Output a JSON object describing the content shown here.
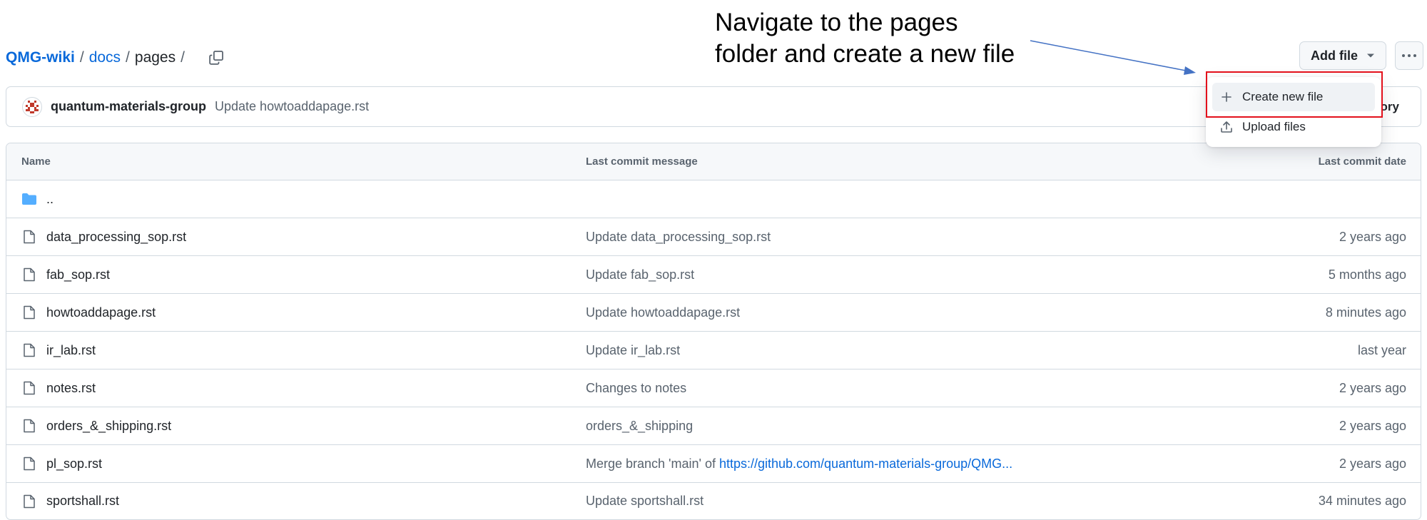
{
  "annotation": {
    "line1": "Navigate to the pages",
    "line2": "folder and create a new file"
  },
  "breadcrumb": {
    "repo": "QMG-wiki",
    "folder": "docs",
    "current": "pages",
    "separator": "/"
  },
  "toolbar": {
    "add_file_label": "Add file",
    "more_label": "···"
  },
  "dropdown": {
    "items": [
      {
        "label": "Create new file",
        "icon": "plus-icon"
      },
      {
        "label": "Upload files",
        "icon": "upload-icon"
      }
    ]
  },
  "commit": {
    "author": "quantum-materials-group",
    "message": "Update howtoaddapage.rst",
    "history_fragment": "ory"
  },
  "table": {
    "headers": {
      "name": "Name",
      "message": "Last commit message",
      "date": "Last commit date"
    },
    "parent_row": {
      "name": ".."
    },
    "rows": [
      {
        "name": "data_processing_sop.rst",
        "message": "Update data_processing_sop.rst",
        "date": "2 years ago"
      },
      {
        "name": "fab_sop.rst",
        "message": "Update fab_sop.rst",
        "date": "5 months ago"
      },
      {
        "name": "howtoaddapage.rst",
        "message": "Update howtoaddapage.rst",
        "date": "8 minutes ago"
      },
      {
        "name": "ir_lab.rst",
        "message": "Update ir_lab.rst",
        "date": "last year"
      },
      {
        "name": "notes.rst",
        "message": "Changes to notes",
        "date": "2 years ago"
      },
      {
        "name": "orders_&_shipping.rst",
        "message": "orders_&_shipping",
        "date": "2 years ago"
      },
      {
        "name": "pl_sop.rst",
        "message": "Merge branch 'main' of ",
        "message_link": "https://github.com/quantum-materials-group/QMG...",
        "date": "2 years ago"
      },
      {
        "name": "sportshall.rst",
        "message": "Update sportshall.rst",
        "date": "34 minutes ago"
      }
    ]
  },
  "colors": {
    "link": "#0969da",
    "muted": "#59636e",
    "border": "#d1d9e0",
    "highlight": "#e3101b",
    "folder": "#54aeff",
    "arrow": "#4472c4"
  }
}
